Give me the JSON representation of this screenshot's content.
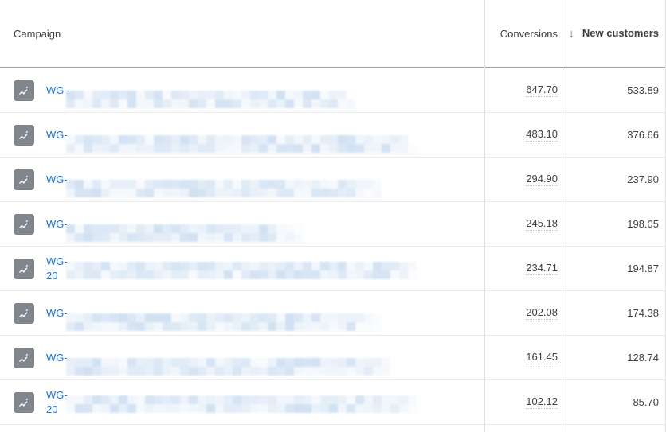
{
  "table": {
    "columns": [
      {
        "key": "campaign",
        "label": "Campaign",
        "align": "left",
        "sorted": false,
        "truncated": false
      },
      {
        "key": "conversions",
        "label": "Conversions",
        "align": "right",
        "sorted": false,
        "truncated": true
      },
      {
        "key": "newcustomers",
        "label": "New customers",
        "align": "right",
        "sorted": true,
        "truncated": true,
        "sort_direction": "descending",
        "sort_icon": "arrow-down-icon"
      }
    ],
    "rows": [
      {
        "icon": "campaign-performance-icon",
        "campaign_prefix": "WG-",
        "campaign_second_line": "",
        "redacted": true,
        "redaction_width_pct": 82,
        "conversions": "647.70",
        "new_customers": "533.89"
      },
      {
        "icon": "campaign-performance-icon",
        "campaign_prefix": "WG-",
        "campaign_second_line": "",
        "redacted": true,
        "redaction_width_pct": 100,
        "conversions": "483.10",
        "new_customers": "376.66"
      },
      {
        "icon": "campaign-performance-icon",
        "campaign_prefix": "WG-",
        "campaign_second_line": "",
        "redacted": true,
        "redaction_width_pct": 88,
        "conversions": "294.90",
        "new_customers": "237.90"
      },
      {
        "icon": "campaign-performance-icon",
        "campaign_prefix": "WG-",
        "campaign_second_line": "",
        "redacted": true,
        "redaction_width_pct": 66,
        "conversions": "245.18",
        "new_customers": "198.05"
      },
      {
        "icon": "campaign-performance-icon",
        "campaign_prefix": "WG-",
        "campaign_second_line": "20",
        "redacted": true,
        "redaction_width_pct": 98,
        "conversions": "234.71",
        "new_customers": "194.87"
      },
      {
        "icon": "campaign-performance-icon",
        "campaign_prefix": "WG-",
        "campaign_second_line": "",
        "redacted": true,
        "redaction_width_pct": 88,
        "conversions": "202.08",
        "new_customers": "174.38"
      },
      {
        "icon": "campaign-performance-icon",
        "campaign_prefix": "WG-",
        "campaign_second_line": "",
        "redacted": true,
        "redaction_width_pct": 92,
        "conversions": "161.45",
        "new_customers": "128.74"
      },
      {
        "icon": "campaign-performance-icon",
        "campaign_prefix": "WG-",
        "campaign_second_line": "20",
        "redacted": true,
        "redaction_width_pct": 98,
        "conversions": "102.12",
        "new_customers": "85.70"
      }
    ]
  },
  "colors": {
    "link": "#1a73e8",
    "text": "#3c4043",
    "icon_background": "#80868b",
    "row_divider": "#e8eaed",
    "header_divider": "#9aa0a6",
    "column_divider": "#e0e0e0",
    "redaction": "#c5d9ef"
  }
}
